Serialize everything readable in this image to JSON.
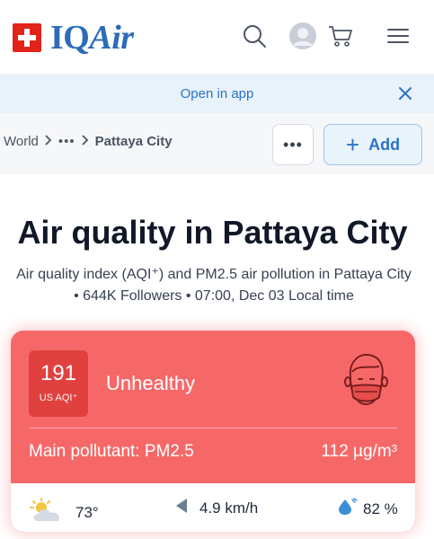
{
  "header": {
    "brand_iq": "IQ",
    "brand_air": "Air"
  },
  "banner": {
    "text": "Open in app"
  },
  "breadcrumb": {
    "root": "World",
    "ellipsis": "•••",
    "current": "Pattaya City"
  },
  "actions": {
    "more_label": "•••",
    "add_label": "Add"
  },
  "page": {
    "title": "Air quality in Pattaya City",
    "subtitle_line1": "Air quality index (AQI⁺) and PM2.5 air pollution in Pattaya City",
    "subtitle_line2": "• 644K Followers • 07:00, Dec 03 Local time"
  },
  "aqi_card": {
    "value": "191",
    "unit": "US AQI⁺",
    "status": "Unhealthy",
    "pollutant_label": "Main pollutant: ",
    "pollutant": "PM2.5",
    "concentration": "112 µg/m³",
    "color": "#f66868",
    "badge_color": "#e0413f"
  },
  "weather": {
    "temperature": "73°",
    "wind": "4.9 km/h",
    "humidity": "82 %"
  },
  "colors": {
    "accent": "#2c73c7",
    "brand": "#2b6cb8",
    "swiss_red": "#e2231a"
  }
}
